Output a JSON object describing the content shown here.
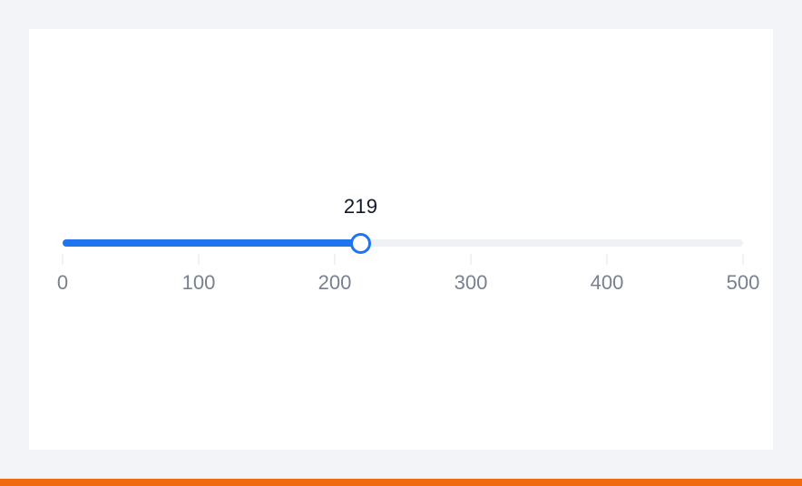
{
  "slider": {
    "min": 0,
    "max": 500,
    "value": 219,
    "value_label": "219",
    "ticks": [
      {
        "value": 0,
        "label": "0"
      },
      {
        "value": 100,
        "label": "100"
      },
      {
        "value": 200,
        "label": "200"
      },
      {
        "value": 300,
        "label": "300"
      },
      {
        "value": 400,
        "label": "400"
      },
      {
        "value": 500,
        "label": "500"
      }
    ]
  },
  "colors": {
    "accent": "#1f75f0",
    "track": "#f0f1f5",
    "background": "#f3f4f7",
    "card": "#ffffff",
    "bottom_bar": "#f06a0f"
  }
}
